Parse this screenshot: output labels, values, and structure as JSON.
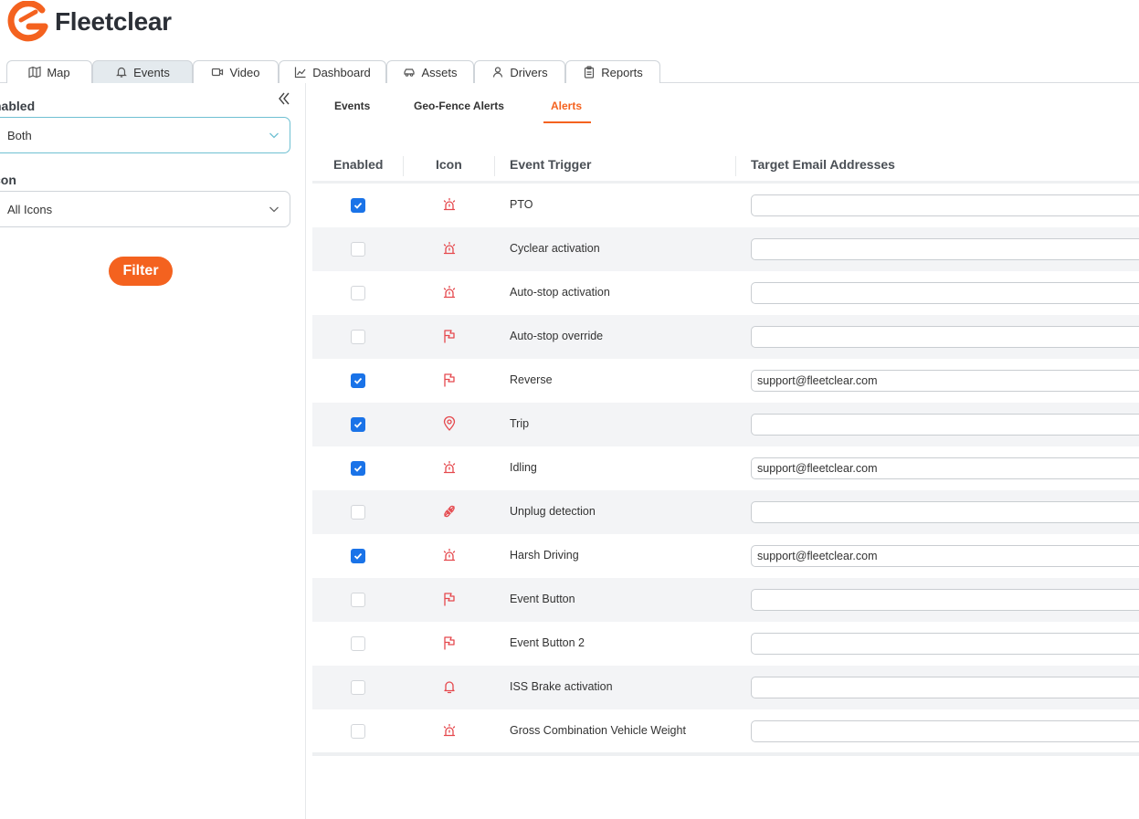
{
  "app": {
    "brand": "Fleetclear"
  },
  "nav_tabs": [
    {
      "label": "Map",
      "icon": "map-icon"
    },
    {
      "label": "Events",
      "icon": "bell-icon",
      "active": true
    },
    {
      "label": "Video",
      "icon": "video-icon"
    },
    {
      "label": "Dashboard",
      "icon": "chart-icon"
    },
    {
      "label": "Assets",
      "icon": "car-icon"
    },
    {
      "label": "Drivers",
      "icon": "user-icon"
    },
    {
      "label": "Reports",
      "icon": "clipboard-icon"
    }
  ],
  "filters": {
    "enabled_label": "nabled",
    "enabled_value": "Both",
    "icon_label": "con",
    "icon_value": "All Icons",
    "filter_button": "Filter"
  },
  "sub_tabs": [
    {
      "label": "Events"
    },
    {
      "label": "Geo-Fence Alerts"
    },
    {
      "label": "Alerts",
      "active": true
    }
  ],
  "table": {
    "headers": [
      "Enabled",
      "Icon",
      "Event Trigger",
      "Target Email Addresses"
    ],
    "rows": [
      {
        "enabled": true,
        "icon": "alarm-icon",
        "trigger": "PTO",
        "email": ""
      },
      {
        "enabled": false,
        "icon": "alarm-icon",
        "trigger": "Cyclear activation",
        "email": ""
      },
      {
        "enabled": false,
        "icon": "alarm-icon",
        "trigger": "Auto-stop activation",
        "email": ""
      },
      {
        "enabled": false,
        "icon": "flag-icon",
        "trigger": "Auto-stop override",
        "email": ""
      },
      {
        "enabled": true,
        "icon": "flag-icon",
        "trigger": "Reverse",
        "email": "support@fleetclear.com"
      },
      {
        "enabled": true,
        "icon": "map-pin-icon",
        "trigger": "Trip",
        "email": ""
      },
      {
        "enabled": true,
        "icon": "alarm-icon",
        "trigger": "Idling",
        "email": "support@fleetclear.com"
      },
      {
        "enabled": false,
        "icon": "unplug-icon",
        "trigger": "Unplug detection",
        "email": ""
      },
      {
        "enabled": true,
        "icon": "alarm-icon",
        "trigger": "Harsh Driving",
        "email": "support@fleetclear.com"
      },
      {
        "enabled": false,
        "icon": "flag-icon",
        "trigger": "Event Button",
        "email": ""
      },
      {
        "enabled": false,
        "icon": "flag-icon",
        "trigger": "Event Button 2",
        "email": ""
      },
      {
        "enabled": false,
        "icon": "bell-icon",
        "trigger": "ISS Brake activation",
        "email": ""
      },
      {
        "enabled": false,
        "icon": "alarm-icon",
        "trigger": "Gross Combination Vehicle Weight",
        "email": ""
      }
    ]
  },
  "colors": {
    "accent": "#f4621f",
    "icon_red": "#e5484d",
    "checkbox_blue": "#1a73e8"
  }
}
